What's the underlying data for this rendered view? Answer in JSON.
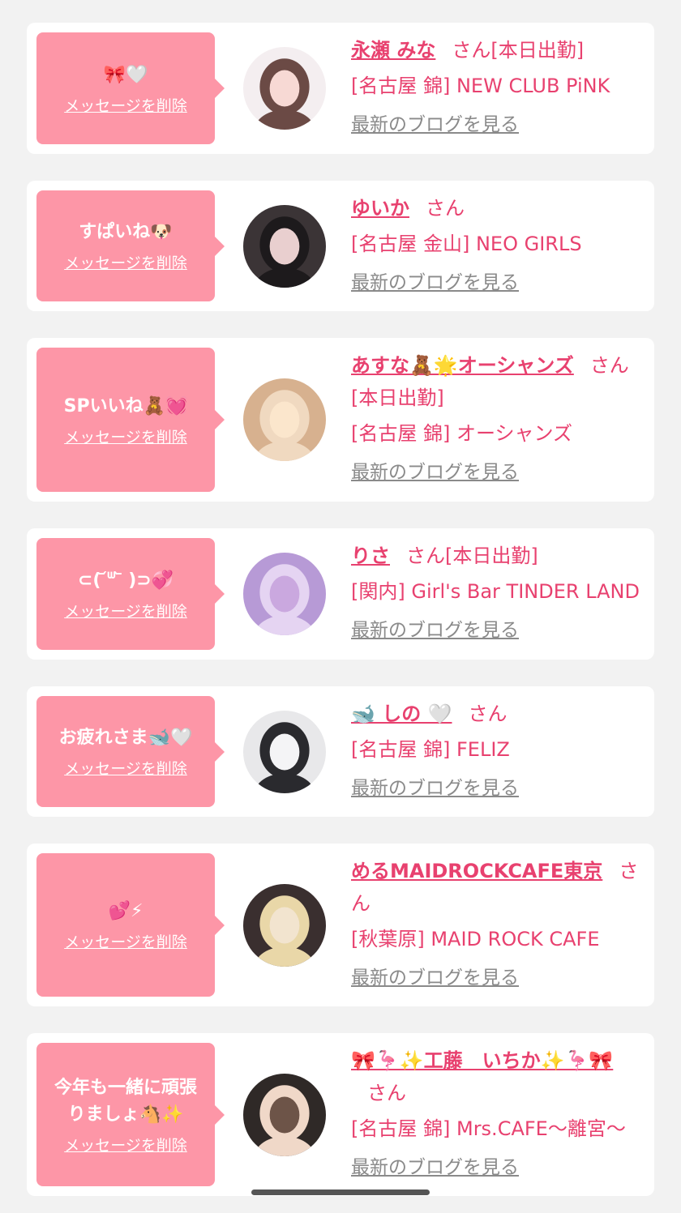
{
  "colors": {
    "background": "#f2f2f2",
    "bubble": "#fd96a7",
    "accent": "#e8416f",
    "link_gray": "#8a8a8a"
  },
  "delete_label": "メッセージを削除",
  "blog_label": "最新のブログを見る",
  "items": [
    {
      "bubble_lines": [
        "🎀🤍"
      ],
      "name": "永瀬 みな",
      "suffix": "さん[本日出勤]",
      "shop": "[名古屋 錦] NEW CLUB PiNK",
      "avatar_icon": "profile-photo"
    },
    {
      "bubble_lines": [
        "すぱいね🐶"
      ],
      "name": "ゆいか",
      "suffix": "さん",
      "shop": "[名古屋 金山] NEO GIRLS",
      "avatar_icon": "profile-photo"
    },
    {
      "bubble_lines": [
        "SPいいね🧸💓"
      ],
      "name": "あすな🧸🌟オーシャンズ",
      "suffix": "さん[本日出勤]",
      "shop": "[名古屋 錦] オーシャンズ",
      "avatar_icon": "profile-photo"
    },
    {
      "bubble_lines": [
        "⊂( ᷄ᐜ ᷅ )⊃💞"
      ],
      "name": "りさ",
      "suffix": "さん[本日出勤]",
      "shop": "[関内] Girl's Bar TINDER LAND",
      "avatar_icon": "profile-photo"
    },
    {
      "bubble_lines": [
        "お疲れさま🐋🤍"
      ],
      "name": "🐋 しの 🤍",
      "suffix": "さん",
      "shop": "[名古屋 錦] FELIZ",
      "avatar_icon": "profile-photo"
    },
    {
      "bubble_lines": [
        "💕⚡"
      ],
      "name": "めるMAIDROCKCAFE東京",
      "suffix": "さん",
      "shop": "[秋葉原] MAID ROCK CAFE",
      "avatar_icon": "profile-photo"
    },
    {
      "bubble_lines": [
        "今年も一緒に頑張",
        "りましょ🐴✨"
      ],
      "name": "🎀🦩✨工藤　いちか✨🦩🎀",
      "suffix": "さん",
      "shop": "[名古屋 錦] Mrs.CAFE〜離宮〜",
      "avatar_icon": "profile-photo"
    }
  ]
}
